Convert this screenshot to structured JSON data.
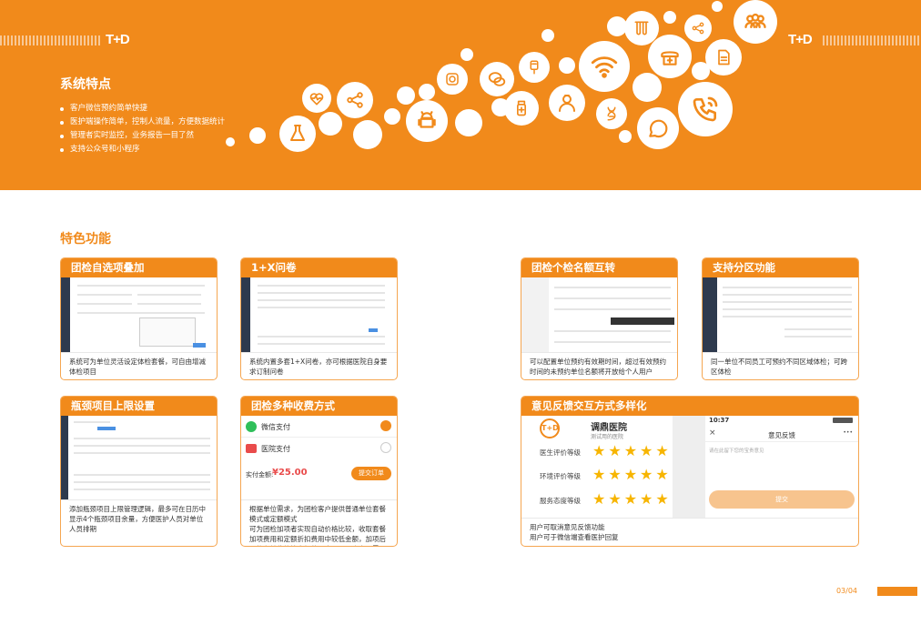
{
  "brand": {
    "logo": "T+D"
  },
  "system": {
    "title": "系统特点",
    "items": [
      "客户微信预约简单快捷",
      "医护端操作简单，控制人流量，方便数据统计",
      "管理者实时监控，业务报告一目了然",
      "支持公众号和小程序"
    ]
  },
  "features": {
    "title": "特色功能",
    "cards": [
      {
        "title": "团检自选项叠加",
        "desc": "系统可为单位灵活设定体检套餐，可自由增减体检项目"
      },
      {
        "title": "1+X问卷",
        "desc": "系统内置多套1+X问卷，亦可根据医院自身要求订制问卷"
      },
      {
        "title": "团检个检名额互转",
        "desc": "可以配置单位预约有效期时间，超过有效预约时间的未预约单位名额将开放给个人用户"
      },
      {
        "title": "支持分区功能",
        "desc": "同一单位不同员工可预约不同区域体检；可跨区体检"
      },
      {
        "title": "瓶颈项目上限设置",
        "desc": "添加瓶颈项目上限管理逻辑，最多可在日历中显示4个瓶颈项目余量，方便医护人员对单位人员排期"
      },
      {
        "title": "团检多种收费方式",
        "desc_lines": [
          "根据单位需求，为团检客户提供普通单位套餐模式或定额模式",
          "可为团检加项者实现自动价格比较，收取套餐加项费用和定额折扣费用中较低金额，加项后价格在单位体检定额范围内，员工个人无需另付费"
        ]
      },
      {
        "title": "意见反馈交互方式多样化",
        "desc_lines": [
          "用户可取消意见反馈功能",
          "用户可于微信端查看医护回复"
        ]
      }
    ]
  },
  "payment": {
    "wechat_label": "微信支付",
    "hospital_label": "医院支付",
    "amount_label": "实付金额:",
    "amount": "¥25.00",
    "submit_label": "提交订单"
  },
  "feedback": {
    "hospital_name": "调鼎医院",
    "hospital_sub": "测试用的医院",
    "ratings": [
      {
        "label": "医生评价等级",
        "stars": 5
      },
      {
        "label": "环境评价等级",
        "stars": 5
      },
      {
        "label": "服务态度等级",
        "stars": 5
      }
    ],
    "phone_time": "10:37",
    "phone_close": "×",
    "phone_title": "意见反馈",
    "phone_more": "•••",
    "phone_placeholder": "请在此留下您的宝贵意见",
    "phone_submit": "提交"
  },
  "page": {
    "number": "03/04"
  },
  "colors": {
    "accent": "#F18A1B",
    "light_accent": "#F5A651",
    "star": "#F7B500"
  }
}
